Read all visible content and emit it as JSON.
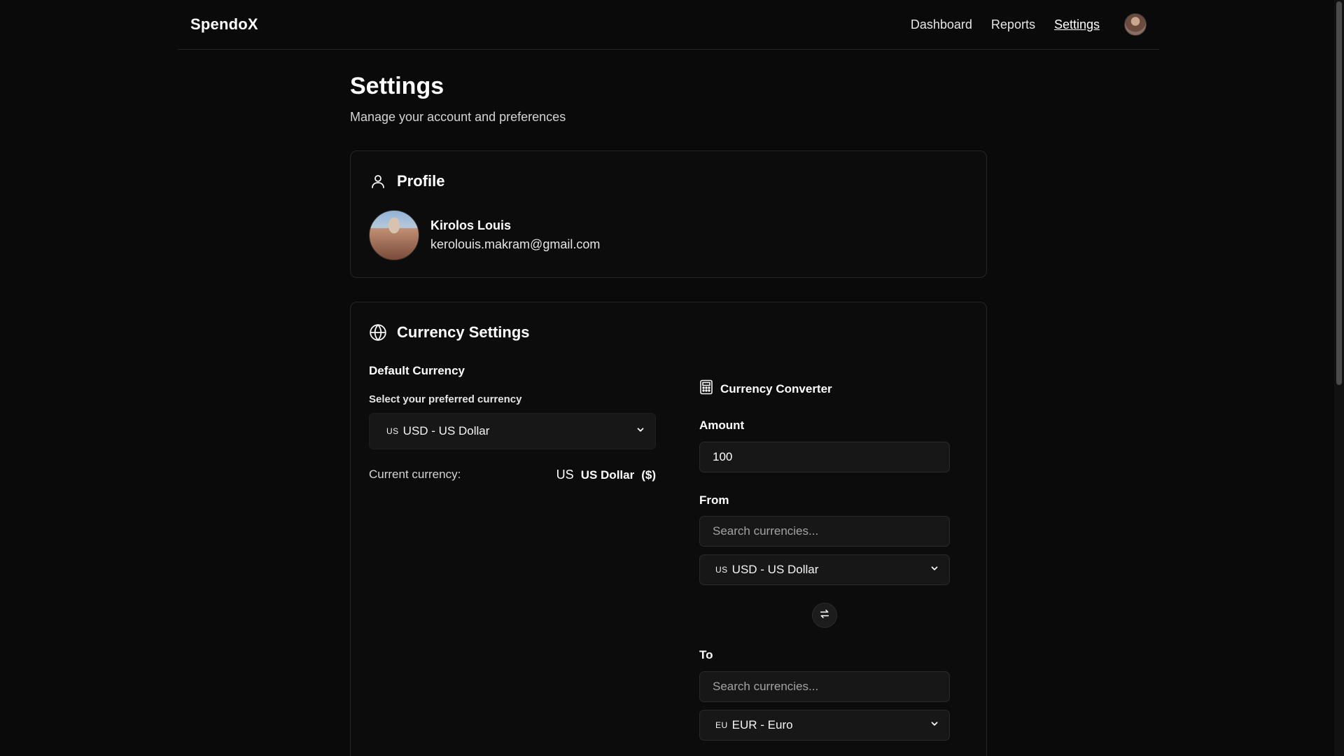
{
  "header": {
    "brand": "SpendoX",
    "nav": [
      {
        "label": "Dashboard",
        "active": false
      },
      {
        "label": "Reports",
        "active": false
      },
      {
        "label": "Settings",
        "active": true
      }
    ]
  },
  "page": {
    "title": "Settings",
    "subtitle": "Manage your account and preferences"
  },
  "profile": {
    "heading": "Profile",
    "name": "Kirolos Louis",
    "email": "kerolouis.makram@gmail.com"
  },
  "currency": {
    "heading": "Currency Settings",
    "default_title": "Default Currency",
    "select_label": "Select your preferred currency",
    "default_selected": {
      "flag": "US",
      "label": "USD - US Dollar"
    },
    "current_label": "Current currency:",
    "current_flag": "US",
    "current_name": "US Dollar",
    "current_symbol": "($)"
  },
  "converter": {
    "heading": "Currency Converter",
    "amount_label": "Amount",
    "amount_value": "100",
    "from_label": "From",
    "from_search_placeholder": "Search currencies...",
    "from_selected": {
      "flag": "US",
      "label": "USD - US Dollar"
    },
    "to_label": "To",
    "to_search_placeholder": "Search currencies...",
    "to_selected": {
      "flag": "EU",
      "label": "EUR - Euro"
    }
  },
  "colors": {
    "background": "#0a0a0a",
    "card_border": "#262626",
    "input_bg": "#171717"
  }
}
